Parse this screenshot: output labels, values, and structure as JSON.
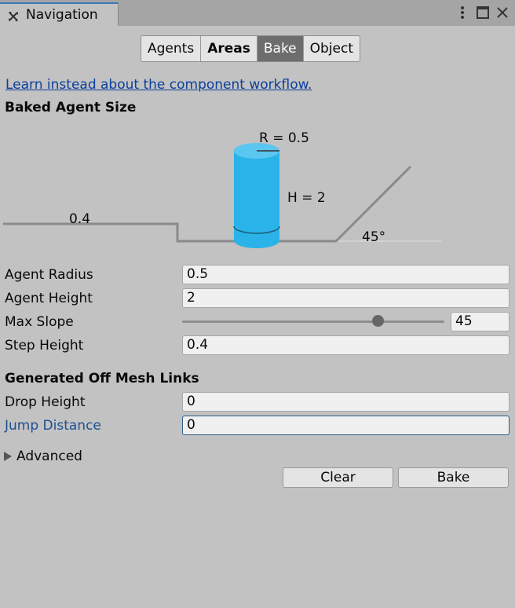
{
  "window": {
    "tab_title": "Navigation",
    "tab_icon": "navigation-icon",
    "menu_icon": "kebab-menu-icon",
    "maximize_icon": "maximize-icon",
    "close_icon": "close-icon"
  },
  "toolbar": {
    "tabs": [
      {
        "label": "Agents",
        "active": false
      },
      {
        "label": "Areas",
        "active": false
      },
      {
        "label": "Bake",
        "active": true
      },
      {
        "label": "Object",
        "active": false
      }
    ]
  },
  "link_text": "Learn instead about the component workflow.",
  "baked_agent_size": {
    "title": "Baked Agent Size",
    "radius_label": "R = 0.5",
    "height_label": "H = 2",
    "step_label": "0.4",
    "slope_label": "45°"
  },
  "fields": {
    "agent_radius": {
      "label": "Agent Radius",
      "value": "0.5"
    },
    "agent_height": {
      "label": "Agent Height",
      "value": "2"
    },
    "max_slope": {
      "label": "Max Slope",
      "value": "45",
      "slider_fraction": 0.745
    },
    "step_height": {
      "label": "Step Height",
      "value": "0.4"
    }
  },
  "off_mesh": {
    "title": "Generated Off Mesh Links",
    "drop_height": {
      "label": "Drop Height",
      "value": "0"
    },
    "jump_distance": {
      "label": "Jump Distance",
      "value": "0"
    }
  },
  "advanced_label": "Advanced",
  "buttons": {
    "clear": "Clear",
    "bake": "Bake"
  },
  "colors": {
    "cylinder": "#29b3e8",
    "focused_label": "#1f4f8f",
    "link": "#0b3f9c",
    "active_tab": "#6d6d6d"
  }
}
